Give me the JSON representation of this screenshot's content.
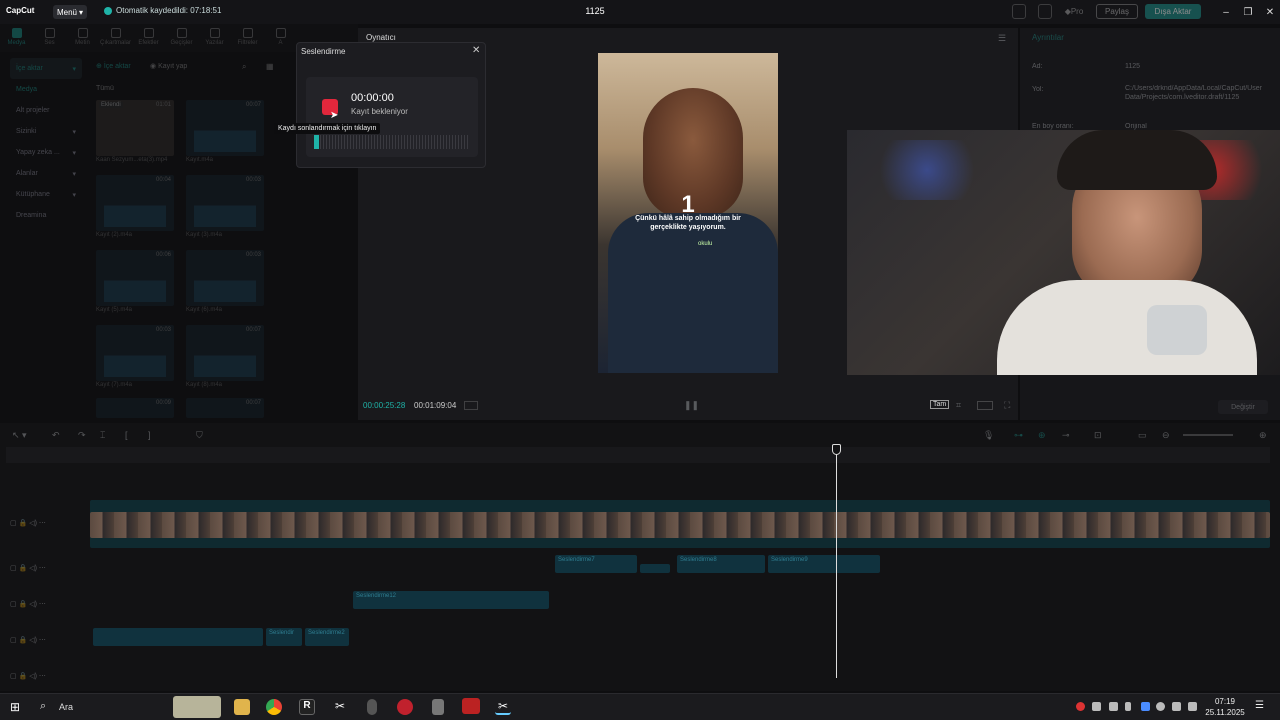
{
  "app": {
    "logo": "CapCut",
    "menu_label": "Menü",
    "autosave_text": "Otomatik kaydedildi: 07:18:51",
    "project_title": "1125",
    "pro_label": "Pro",
    "share_label": "Paylaş",
    "export_label": "Dışa Aktar"
  },
  "toolbar": {
    "tools": [
      "Medya",
      "Ses",
      "Metin",
      "Çıkartmalar",
      "Efektler",
      "Geçişler",
      "Yazılar",
      "Filtreler",
      "A"
    ]
  },
  "sidebar": {
    "items": [
      {
        "label": "İçe aktar"
      },
      {
        "label": "Medya"
      },
      {
        "label": "Alt projeler"
      },
      {
        "label": "Sizinki"
      },
      {
        "label": "Yapay zeka ..."
      },
      {
        "label": "Alanlar"
      },
      {
        "label": "Kütüphane"
      },
      {
        "label": "Dreamina"
      }
    ]
  },
  "media": {
    "import_label": "İçe aktar",
    "record_label": "Kayıt yap",
    "all_label": "Tümü",
    "items": [
      {
        "name": "Kaan Sezyum...eta(3).mp4",
        "duration": "01:01",
        "badge": "Eklendi"
      },
      {
        "name": "Kayıt.m4a",
        "duration": "00:07"
      },
      {
        "name": "Kayıt (2).m4a",
        "duration": "00:04"
      },
      {
        "name": "Kayıt (3).m4a",
        "duration": "00:03"
      },
      {
        "name": "Kayıt (5).m4a",
        "duration": "00:06"
      },
      {
        "name": "Kayıt (6).m4a",
        "duration": "00:03"
      },
      {
        "name": "Kayıt (7).m4a",
        "duration": "00:03"
      },
      {
        "name": "Kayıt (8).m4a",
        "duration": "00:07"
      },
      {
        "name": "",
        "duration": "00:09"
      },
      {
        "name": "",
        "duration": "00:07"
      }
    ]
  },
  "player": {
    "title": "Oynatıcı",
    "current_time": "00:00:25:28",
    "total_time": "00:01:09:04",
    "fit_label": "Tam",
    "subtitle_line1": "Çünkü hâlâ sahip olmadığım bir",
    "subtitle_line2": "gerçeklikte yaşıyorum.",
    "big_number": "1",
    "watermark": "okulu"
  },
  "details": {
    "title": "Ayrıntılar",
    "rows": [
      {
        "key": "Ad:",
        "value": "1125"
      },
      {
        "key": "Yol:",
        "value": "C:/Users/drknd/AppData/Local/CapCut/User Data/Projects/com.lveditor.draft/1125"
      },
      {
        "key": "En boy oranı:",
        "value": "Orijinal"
      }
    ],
    "change_label": "Değiştir"
  },
  "dialog": {
    "title": "Seslendirme",
    "time": "00:00:00",
    "status": "Kayıt bekleniyor",
    "tooltip": "Kaydı sonlandırmak için tıklayın"
  },
  "timeline": {
    "clips_audio1": [
      "Seslendirme7",
      "Seslendirme8",
      "Seslendirme9"
    ],
    "clip_audio2": "Seslendirme12",
    "clips_audio3": [
      "Seslendir",
      "Seslendirme2"
    ]
  },
  "taskbar": {
    "search_label": "Ara",
    "time": "07:19",
    "date": "25.11.2025"
  },
  "colors": {
    "accent": "#1fb3a8",
    "record": "#e1273c",
    "export": "#1a8f87"
  }
}
